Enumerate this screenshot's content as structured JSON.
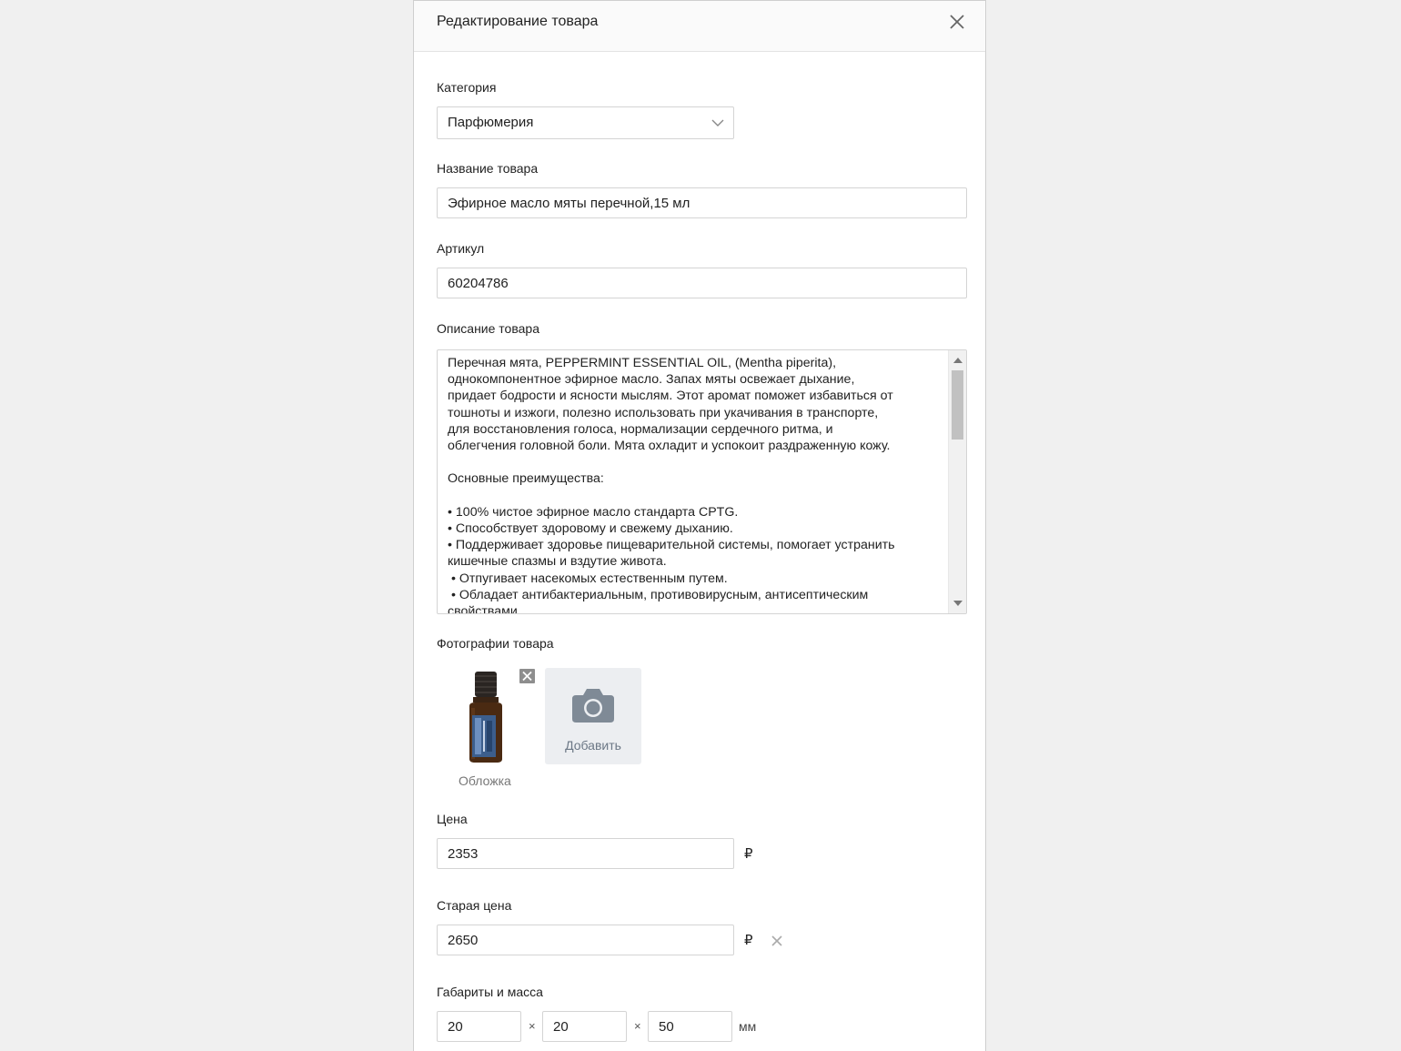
{
  "modal": {
    "title": "Редактирование товара"
  },
  "category": {
    "label": "Категория",
    "value": "Парфюмерия"
  },
  "name": {
    "label": "Название товара",
    "value": "Эфирное масло мяты перечной,15 мл"
  },
  "article": {
    "label": "Артикул",
    "value": "60204786"
  },
  "description": {
    "label": "Описание товара",
    "value": "Перечная мята, PEPPERMINT ESSENTIAL OIL, (Mentha piperita),\nоднокомпонентное эфирное масло. Запах мяты освежает дыхание,\nпридает бодрости и ясности мыслям. Этот аромат поможет избавиться от\nтошноты и изжоги, полезно использовать при укачивания в транспорте,\nдля восстановления голоса, нормализации сердечного ритма, и\nоблегчения головной боли. Мята охладит и успокоит раздраженную кожу.\n\nОсновные преимущества:\n\n• 100% чистое эфирное масло стандарта CPTG.\n• Способствует здоровому и свежему дыханию.\n• Поддерживает здоровье пищеварительной системы, помогает устранить\nкишечные спазмы и вздутие живота.\n • Отпугивает насекомых естественным путем.\n • Обладает антибактериальным, противовирусным, антисептическим\nсвойствами."
  },
  "photos": {
    "label": "Фотографии товара",
    "cover_caption": "Обложка",
    "add_label": "Добавить"
  },
  "price": {
    "label": "Цена",
    "value": "2353",
    "currency": "₽"
  },
  "old_price": {
    "label": "Старая цена",
    "value": "2650",
    "currency": "₽"
  },
  "dimensions": {
    "label": "Габариты и масса",
    "length": "20",
    "width": "20",
    "height": "50",
    "separator": "×",
    "unit": "мм"
  }
}
